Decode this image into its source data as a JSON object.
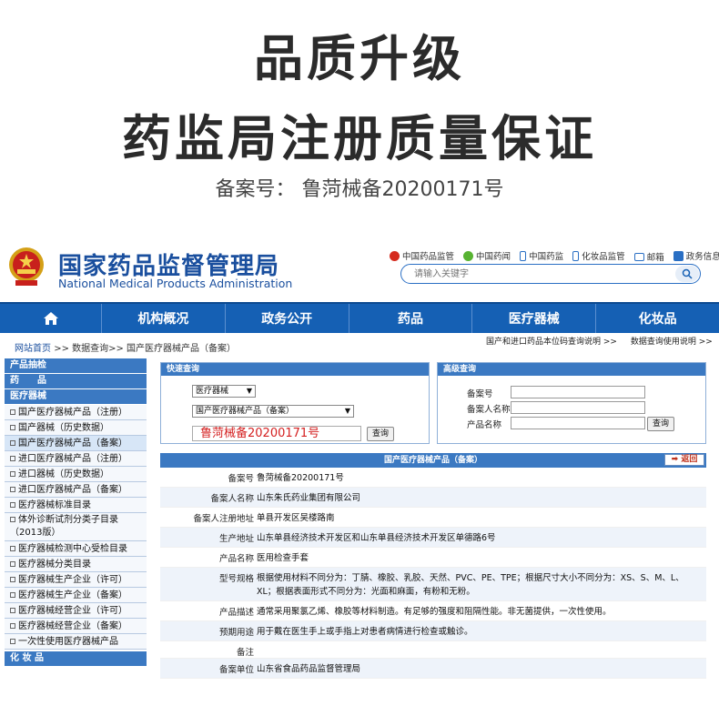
{
  "promo": {
    "title_line1": "品质升级",
    "title_line2": "药监局注册质量保证",
    "registration": "备案号：  鲁菏械备20200171号"
  },
  "site": {
    "org_name_cn": "国家药品监督管理局",
    "org_name_en": "National Medical Products Administration",
    "top_links": [
      {
        "label": "中国药品监管",
        "icon": "weibo-icon",
        "color": "#d52b1e"
      },
      {
        "label": "中国药闻",
        "icon": "wechat-icon",
        "color": "#58b332"
      },
      {
        "label": "中国药监",
        "icon": "phone-icon",
        "color": "#2a6fc4"
      },
      {
        "label": "化妆品监管",
        "icon": "phone-icon",
        "color": "#2a6fc4"
      },
      {
        "label": "邮箱",
        "icon": "mail-icon",
        "color": "#2a6fc4"
      },
      {
        "label": "政务信息投诉",
        "icon": "complaint-icon",
        "color": "#2a6fc4"
      }
    ],
    "search_placeholder": "请输入关键字",
    "nav": [
      "机构概况",
      "政务公开",
      "药品",
      "医疗器械",
      "化妆品"
    ],
    "breadcrumb_home": "网站首页",
    "breadcrumb_rest": ">> 数据查询>> 国产医疗器械产品（备案）",
    "right_links": [
      "国产和进口药品本位码查询说明 >>",
      "数据查询使用说明 >>"
    ]
  },
  "sidebar": {
    "headers": [
      "产品抽检",
      "药　　品",
      "医疗器械"
    ],
    "items": [
      {
        "label": "国产医疗器械产品（注册）",
        "active": false
      },
      {
        "label": "国产器械（历史数据）",
        "active": false
      },
      {
        "label": "国产医疗器械产品（备案）",
        "active": true
      },
      {
        "label": "进口医疗器械产品（注册）",
        "active": false
      },
      {
        "label": "进口器械（历史数据）",
        "active": false
      },
      {
        "label": "进口医疗器械产品（备案）",
        "active": false
      },
      {
        "label": "医疗器械标准目录",
        "active": false
      },
      {
        "label": "体外诊断试剂分类子目录（2013版）",
        "active": false,
        "tall": true
      },
      {
        "label": "医疗器械检测中心受检目录",
        "active": false
      },
      {
        "label": "医疗器械分类目录",
        "active": false
      },
      {
        "label": "医疗器械生产企业（许可）",
        "active": false
      },
      {
        "label": "医疗器械生产企业（备案）",
        "active": false
      },
      {
        "label": "医疗器械经营企业（许可）",
        "active": false
      },
      {
        "label": "医疗器械经营企业（备案）",
        "active": false
      },
      {
        "label": "一次性使用医疗器械产品",
        "active": false
      }
    ],
    "footer": "化 妆 品"
  },
  "quick": {
    "title": "快速查询",
    "select1": "医疗器械",
    "select2": "国产医疗器械产品（备案）",
    "input_value": "鲁菏械备20200171号",
    "button": "查询"
  },
  "advanced": {
    "title": "高级查询",
    "labels": [
      "备案号",
      "备案人名称",
      "产品名称"
    ],
    "button": "查询"
  },
  "detail": {
    "title": "国产医疗器械产品（备案）",
    "back": "返回",
    "rows": [
      {
        "label": "备案号",
        "value": "鲁菏械备20200171号"
      },
      {
        "label": "备案人名称",
        "value": "山东朱氏药业集团有限公司"
      },
      {
        "label": "备案人注册地址",
        "value": "单县开发区吴楼路南"
      },
      {
        "label": "生产地址",
        "value": "山东单县经济技术开发区和山东单县经济技术开发区单德路6号"
      },
      {
        "label": "产品名称",
        "value": "医用检查手套"
      },
      {
        "label": "型号规格",
        "value": "根据使用材料不同分为：丁腈、橡胶、乳胶、天然、PVC、PE、TPE；根据尺寸大小不同分为：XS、S、M、L、XL；根据表面形式不同分为：光面和麻面，有粉和无粉。"
      },
      {
        "label": "产品描述",
        "value": "通常采用聚氯乙烯、橡胶等材料制造。有足够的强度和阻隔性能。非无菌提供，一次性使用。"
      },
      {
        "label": "预期用途",
        "value": "用于戴在医生手上或手指上对患者病情进行检查或触诊。"
      },
      {
        "label": "备注",
        "value": ""
      },
      {
        "label": "备案单位",
        "value": "山东省食品药品监督管理局"
      }
    ]
  }
}
